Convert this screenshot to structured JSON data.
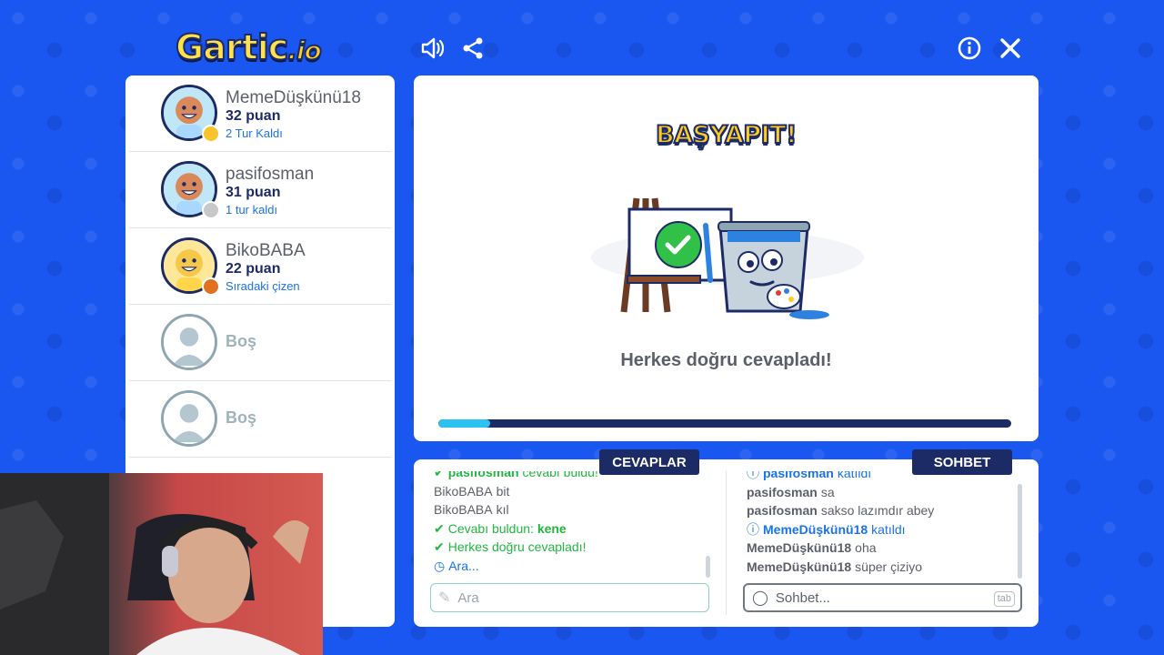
{
  "header": {
    "logo_text": "Gartic",
    "logo_suffix": ".io",
    "icons": [
      "sound-icon",
      "share-icon",
      "info-icon",
      "close-icon"
    ]
  },
  "players": [
    {
      "name": "MemeDüşkünü18",
      "points": "32 puan",
      "status": "2 Tur Kaldı",
      "skin": "#d9895a",
      "badge": "#f7c52a"
    },
    {
      "name": "pasifosman",
      "points": "31 puan",
      "status": "1 tur kaldı",
      "skin": "#d9895a",
      "badge": "#c8c8c8"
    },
    {
      "name": "BikoBABA",
      "points": "22 puan",
      "status": "Sıradaki çizen",
      "skin": "#f5c84a",
      "badge": "#e0711f"
    },
    {
      "name": "Boş"
    },
    {
      "name": "Boş"
    }
  ],
  "board": {
    "title": "BAŞYAPIT!",
    "result": "Herkes doğru cevapladı!",
    "progress": 0.09
  },
  "answers": {
    "tab_label": "CEVAPLAR",
    "messages": [
      {
        "user": "pasifosman",
        "text": "cevabı buldu!"
      },
      {
        "user": "BikoBABA",
        "text": "bit"
      },
      {
        "user": "BikoBABA",
        "text": "kıl"
      },
      {
        "prefix": "Cevabı buldun: ",
        "text": "kene"
      },
      {
        "text": "Herkes doğru cevapladı!"
      },
      {
        "text": "Ara..."
      }
    ],
    "input_placeholder": "Ara"
  },
  "chat": {
    "tab_label": "SOHBET",
    "messages": [
      {
        "user": "pasifosman",
        "text": "katıldı"
      },
      {
        "user": "pasifosman",
        "text": "sa"
      },
      {
        "user": "pasifosman",
        "text": "sakso lazımdır abey"
      },
      {
        "user": "MemeDüşkünü18",
        "text": "katıldı"
      },
      {
        "user": "MemeDüşkünü18",
        "text": "oha"
      },
      {
        "user": "MemeDüşkünü18",
        "text": "süper çiziyo"
      }
    ],
    "input_placeholder": "Sohbet...",
    "tab_key": "tab"
  },
  "colors": {
    "background": "#1a57f0",
    "navy": "#1c2b66",
    "accent_blue": "#1a73e8",
    "success_green": "#23b640",
    "title_yellow": "#ffcc1e"
  }
}
